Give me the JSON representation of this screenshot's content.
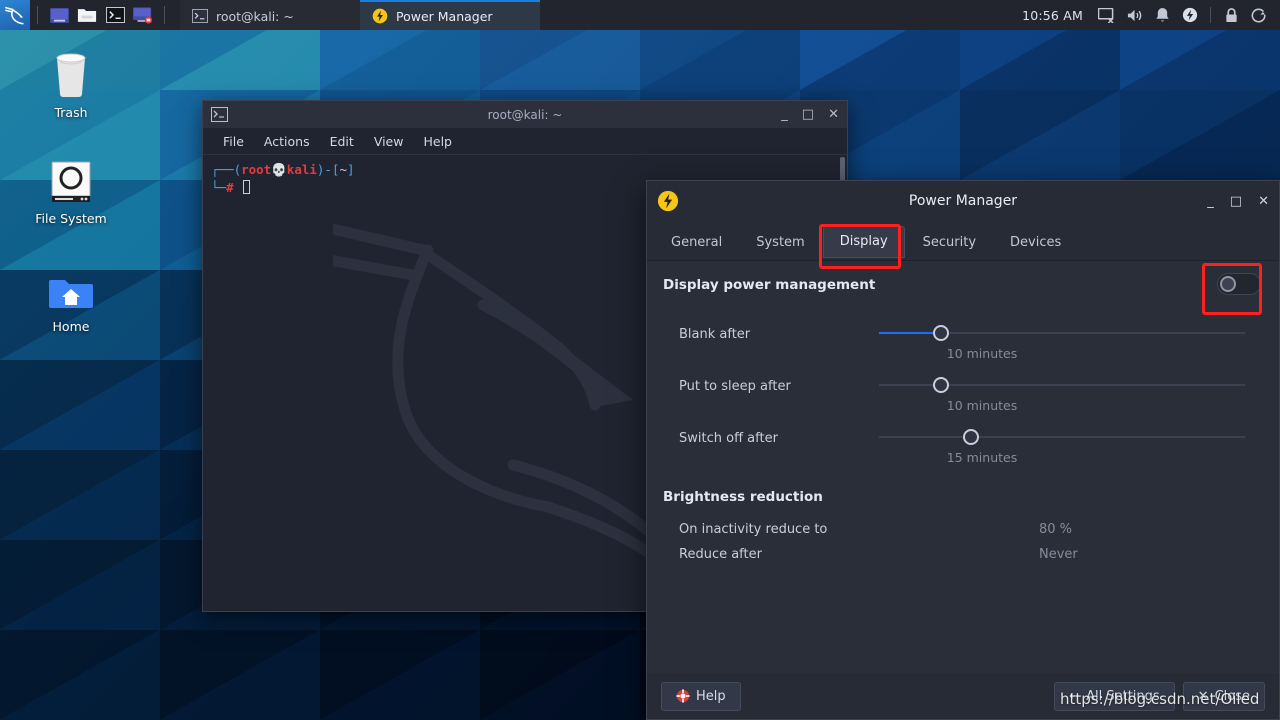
{
  "panel": {
    "launchers": [
      {
        "name": "kali-menu-icon",
        "label": "Kali Menu"
      },
      {
        "name": "terminal-emulator-icon",
        "label": "Terminal Emulator"
      },
      {
        "name": "file-manager-icon",
        "label": "File Manager"
      },
      {
        "name": "terminal-icon",
        "label": "Terminal"
      },
      {
        "name": "screen-recorder-icon",
        "label": "Screen Recorder"
      }
    ],
    "window_buttons": [
      {
        "label": "root@kali: ~",
        "icon": "terminal-icon",
        "active": false
      },
      {
        "label": "Power Manager",
        "icon": "power-bolt-icon",
        "active": true
      }
    ],
    "clock": "10:56 AM",
    "tray": [
      {
        "name": "display-icon"
      },
      {
        "name": "volume-icon"
      },
      {
        "name": "notification-bell-icon"
      },
      {
        "name": "power-bolt-icon"
      },
      {
        "name": "lock-icon"
      },
      {
        "name": "logout-icon"
      }
    ]
  },
  "desktop": {
    "icons": [
      {
        "label": "Trash",
        "icon": "trash-icon"
      },
      {
        "label": "File System",
        "icon": "drive-icon"
      },
      {
        "label": "Home",
        "icon": "home-folder-icon"
      }
    ]
  },
  "terminal": {
    "title": "root@kali: ~",
    "menu": [
      "File",
      "Actions",
      "Edit",
      "View",
      "Help"
    ],
    "prompt": {
      "user": "root",
      "host": "kali",
      "path": "~",
      "symbol": "#"
    },
    "window_controls": {
      "minimize": "_",
      "maximize": "□",
      "close": "✕"
    }
  },
  "power_manager": {
    "title": "Power Manager",
    "window_controls": {
      "minimize": "_",
      "maximize": "□",
      "close": "✕"
    },
    "tabs": [
      {
        "label": "General",
        "selected": false
      },
      {
        "label": "System",
        "selected": false
      },
      {
        "label": "Display",
        "selected": true
      },
      {
        "label": "Security",
        "selected": false
      },
      {
        "label": "Devices",
        "selected": false
      }
    ],
    "display_section": {
      "heading": "Display power management",
      "toggle_state": "off",
      "sliders": [
        {
          "label": "Blank after",
          "value": "10 minutes",
          "percent": 17,
          "filled": true
        },
        {
          "label": "Put to sleep after",
          "value": "10 minutes",
          "percent": 17,
          "filled": false
        },
        {
          "label": "Switch off after",
          "value": "15 minutes",
          "percent": 25,
          "filled": false
        }
      ]
    },
    "brightness_section": {
      "heading": "Brightness reduction",
      "rows": [
        {
          "key": "On inactivity reduce to",
          "value": "80 %"
        },
        {
          "key": "Reduce after",
          "value": "Never"
        }
      ]
    },
    "footer": {
      "help_label": "Help",
      "all_settings_label": "All Settings",
      "close_label": "Close",
      "back_arrow": "←",
      "close_x": "✕"
    }
  },
  "overlay": {
    "watermark": "https://blog.csdn.net/Oiled"
  },
  "colors": {
    "accent_blue": "#1d6ef0",
    "annotation_red": "#ff1f1f",
    "panel_bg": "#22252d",
    "window_bg": "#2a2e39",
    "power_yellow": "#f5c518"
  }
}
